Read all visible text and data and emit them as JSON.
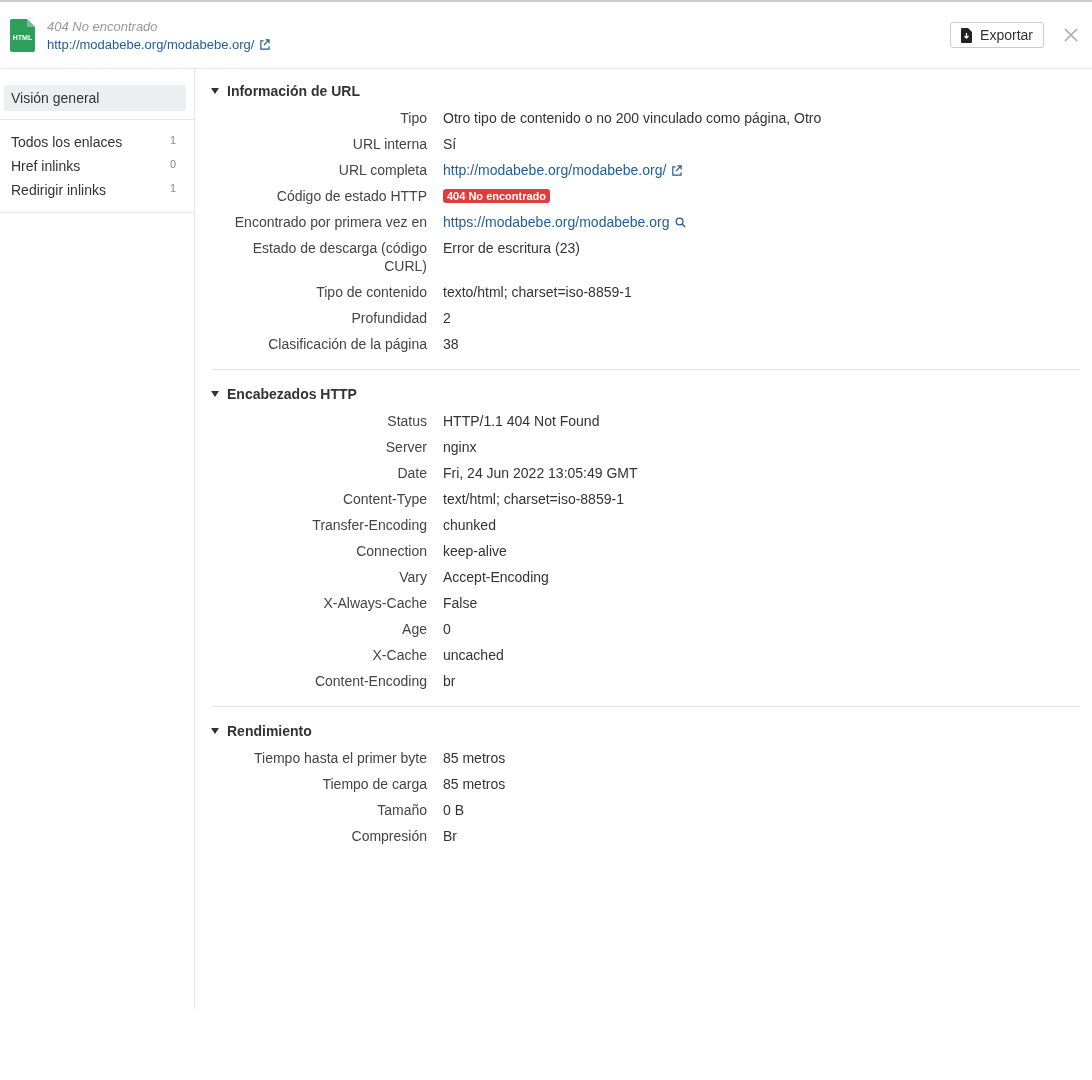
{
  "header": {
    "file_icon_label": "HTML",
    "status": "404 No encontrado",
    "url": "http://modabebe.org/modabebe.org/",
    "export_button": "Exportar"
  },
  "sidebar": {
    "items": [
      {
        "label": "Visión general",
        "selected": true
      },
      {
        "label": "Todos los enlaces",
        "count": "1",
        "selected": false
      },
      {
        "label": "Href inlinks",
        "count": "0",
        "selected": false
      },
      {
        "label": "Redirigir inlinks",
        "count": "1",
        "selected": false
      }
    ]
  },
  "sections": [
    {
      "title": "Información de URL",
      "expanded": true,
      "rows": [
        {
          "label": "Tipo",
          "value": "Otro tipo de contenido o no 200 vinculado como página, Otro",
          "kind": "text"
        },
        {
          "label": "URL interna",
          "value": "Sí",
          "kind": "text"
        },
        {
          "label": "URL completa",
          "value": "http://modabebe.org/modabebe.org/",
          "kind": "external-link"
        },
        {
          "label": "Código de estado HTTP",
          "value": "404 No encontrado",
          "kind": "badge"
        },
        {
          "label": "Encontrado por primera vez en",
          "value": "https://modabebe.org/modabebe.org",
          "kind": "search-link"
        },
        {
          "label": "Estado de descarga (código CURL)",
          "value": "Error de escritura (23)",
          "kind": "text"
        },
        {
          "label": "Tipo de contenido",
          "value": "texto/html; charset=iso-8859-1",
          "kind": "text"
        },
        {
          "label": "Profundidad",
          "value": "2",
          "kind": "text"
        },
        {
          "label": "Clasificación de la página",
          "value": "38",
          "kind": "text"
        }
      ]
    },
    {
      "title": "Encabezados HTTP",
      "expanded": true,
      "rows": [
        {
          "label": "Status",
          "value": "HTTP/1.1 404 Not Found",
          "kind": "text"
        },
        {
          "label": "Server",
          "value": "nginx",
          "kind": "text"
        },
        {
          "label": "Date",
          "value": "Fri, 24 Jun 2022 13:05:49 GMT",
          "kind": "text"
        },
        {
          "label": "Content-Type",
          "value": "text/html; charset=iso-8859-1",
          "kind": "text"
        },
        {
          "label": "Transfer-Encoding",
          "value": "chunked",
          "kind": "text"
        },
        {
          "label": "Connection",
          "value": "keep-alive",
          "kind": "text"
        },
        {
          "label": "Vary",
          "value": "Accept-Encoding",
          "kind": "text"
        },
        {
          "label": "X-Always-Cache",
          "value": "False",
          "kind": "text"
        },
        {
          "label": "Age",
          "value": "0",
          "kind": "text"
        },
        {
          "label": "X-Cache",
          "value": "uncached",
          "kind": "text"
        },
        {
          "label": "Content-Encoding",
          "value": "br",
          "kind": "text"
        }
      ]
    },
    {
      "title": "Rendimiento",
      "expanded": true,
      "rows": [
        {
          "label": "Tiempo hasta el primer byte",
          "value": "85 metros",
          "kind": "text"
        },
        {
          "label": "Tiempo de carga",
          "value": "85 metros",
          "kind": "text"
        },
        {
          "label": "Tamaño",
          "value": "0 B",
          "kind": "text"
        },
        {
          "label": "Compresión",
          "value": "Br",
          "kind": "text"
        }
      ]
    }
  ]
}
